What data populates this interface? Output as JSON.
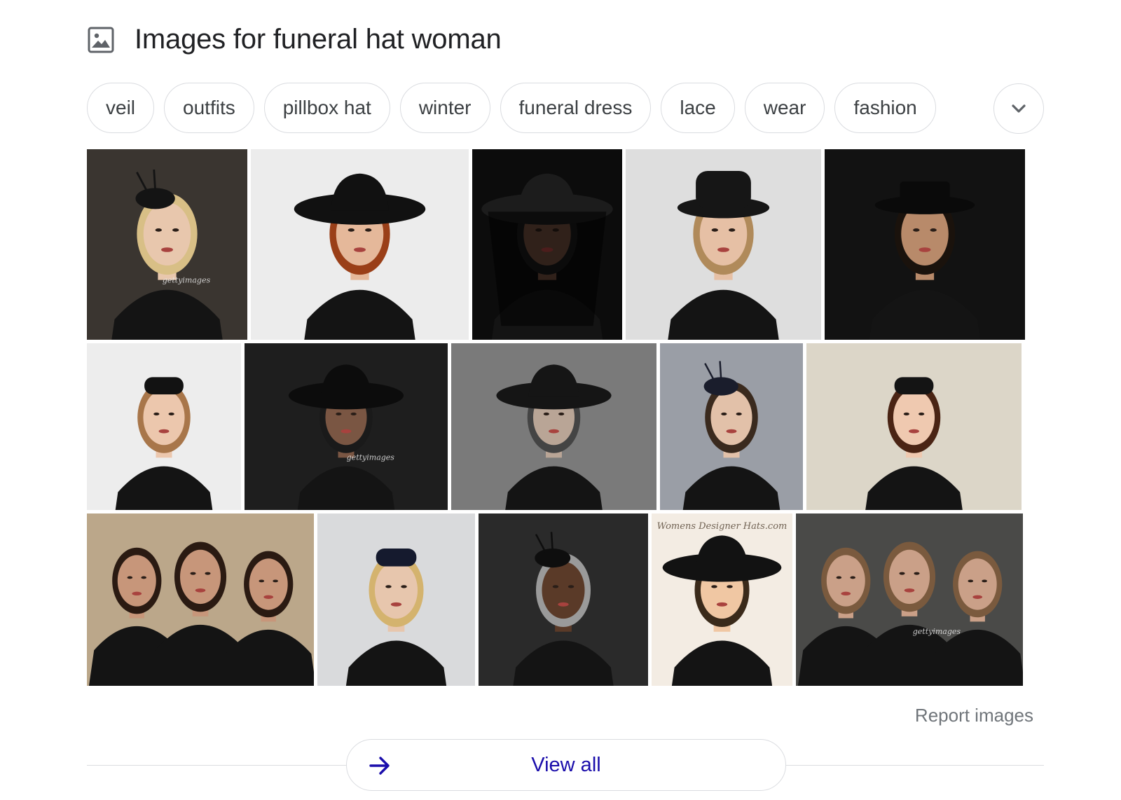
{
  "header": {
    "title": "Images for funeral hat woman",
    "icon": "image-icon"
  },
  "chips": [
    "veil",
    "outfits",
    "pillbox hat",
    "winter",
    "funeral dress",
    "lace",
    "wear",
    "fashion"
  ],
  "expand_icon": "chevron-down-icon",
  "image_rows": [
    [
      {
        "bg": "#3a3530",
        "skin": "#e8c7ad",
        "hair": "#d8bf86",
        "hat": "#141414",
        "style": "fascinator",
        "wm": "gettyimages"
      },
      {
        "bg": "#ececec",
        "skin": "#e5b89a",
        "hair": "#9a3f18",
        "hat": "#111111",
        "style": "wide"
      },
      {
        "bg": "#0c0c0c",
        "skin": "#6b4a3a",
        "hair": "#1a1a1a",
        "hat": "#1c1c1c",
        "style": "veil"
      },
      {
        "bg": "#dedede",
        "skin": "#e6c0a5",
        "hair": "#b08a5a",
        "hat": "#161616",
        "style": "bowler"
      },
      {
        "bg": "#121212",
        "skin": "#b88a6a",
        "hair": "#1a120c",
        "hat": "#0a0a0a",
        "style": "boater"
      }
    ],
    [
      {
        "bg": "#ededed",
        "skin": "#ecc7ad",
        "hair": "#a8764a",
        "hat": "#121212",
        "style": "pillbox"
      },
      {
        "bg": "#1e1e1e",
        "skin": "#7a5643",
        "hair": "#1a1a1a",
        "hat": "#0c0c0c",
        "style": "wide",
        "wm": "gettyimages"
      },
      {
        "bg": "#7a7a7a",
        "skin": "#b9a596",
        "hair": "#444444",
        "hat": "#151515",
        "style": "wide"
      },
      {
        "bg": "#9a9ea6",
        "skin": "#e2c1a9",
        "hair": "#3a2a1e",
        "hat": "#1a1d2c",
        "style": "fascinator"
      },
      {
        "bg": "#dcd6c8",
        "skin": "#efc9b0",
        "hair": "#4a2414",
        "hat": "#141414",
        "style": "pillbox"
      }
    ],
    [
      {
        "bg": "#bba78a",
        "skin": "#c7967a",
        "hair": "#2a1a12",
        "hat": "#0e0e0e",
        "style": "group"
      },
      {
        "bg": "#d9dadc",
        "skin": "#e7c6ad",
        "hair": "#d4b36e",
        "hat": "#151a2e",
        "style": "pillbox"
      },
      {
        "bg": "#2a2a2a",
        "skin": "#5a3a28",
        "hair": "#9a9a9a",
        "hat": "#0e0e0e",
        "style": "fascinator"
      },
      {
        "bg": "#f3ece3",
        "skin": "#f0c7a3",
        "hair": "#3a2a1a",
        "hat": "#121212",
        "style": "wide",
        "wm": "Womens Designer Hats.com"
      },
      {
        "bg": "#4a4a48",
        "skin": "#caa088",
        "hair": "#7a5a3e",
        "hat": "#15161c",
        "style": "group",
        "wm": "gettyimages"
      }
    ]
  ],
  "report_images": "Report images",
  "view_all": "View all",
  "view_all_icon": "arrow-right-icon",
  "colors": {
    "link": "#1a0dab",
    "border": "#dadce0",
    "muted": "#70757a"
  }
}
